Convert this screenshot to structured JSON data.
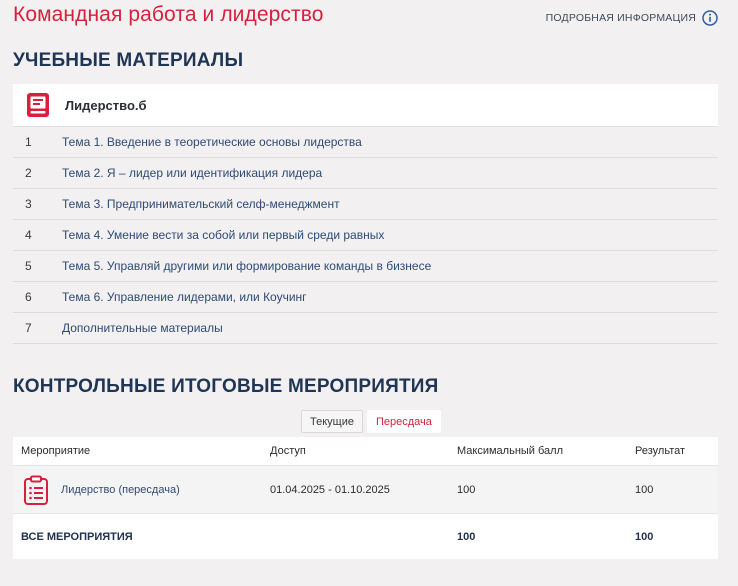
{
  "header": {
    "title": "Командная работа и лидерство",
    "more_info_label": "ПОДРОБНАЯ ИНФОРМАЦИЯ"
  },
  "materials": {
    "section_title": "УЧЕБНЫЕ МАТЕРИАЛЫ",
    "course_name": "Лидерство.б",
    "topics": [
      {
        "num": "1",
        "label": "Тема 1. Введение в теоретические основы лидерства"
      },
      {
        "num": "2",
        "label": "Тема 2. Я – лидер или идентификация лидера"
      },
      {
        "num": "3",
        "label": "Тема 3. Предпринимательский селф-менеджмент"
      },
      {
        "num": "4",
        "label": "Тема 4. Умение вести за собой или первый среди равных"
      },
      {
        "num": "5",
        "label": "Тема 5. Управляй другими или формирование команды в бизнесе"
      },
      {
        "num": "6",
        "label": "Тема 6. Управление лидерами, или Коучинг"
      },
      {
        "num": "7",
        "label": "Дополнительные материалы"
      }
    ]
  },
  "events": {
    "section_title": "КОНТРОЛЬНЫЕ ИТОГОВЫЕ МЕРОПРИЯТИЯ",
    "tabs": [
      {
        "label": "Текущие",
        "active": true
      },
      {
        "label": "Пересдача",
        "active": false
      }
    ],
    "columns": [
      "Мероприятие",
      "Доступ",
      "Максимальный балл",
      "Результат"
    ],
    "rows": [
      {
        "name": "Лидерство (пересдача)",
        "access": "01.04.2025 - 01.10.2025",
        "max_score": "100",
        "result": "100"
      }
    ],
    "total": {
      "label": "ВСЕ МЕРОПРИЯТИЯ",
      "max_score": "100",
      "result": "100"
    }
  },
  "colors": {
    "accent_red": "#d8203d",
    "heading_navy": "#1f3555",
    "link_blue": "#2e4a73"
  },
  "icons": {
    "info": "info-circle-icon",
    "course": "book-icon",
    "event": "clipboard-icon"
  }
}
